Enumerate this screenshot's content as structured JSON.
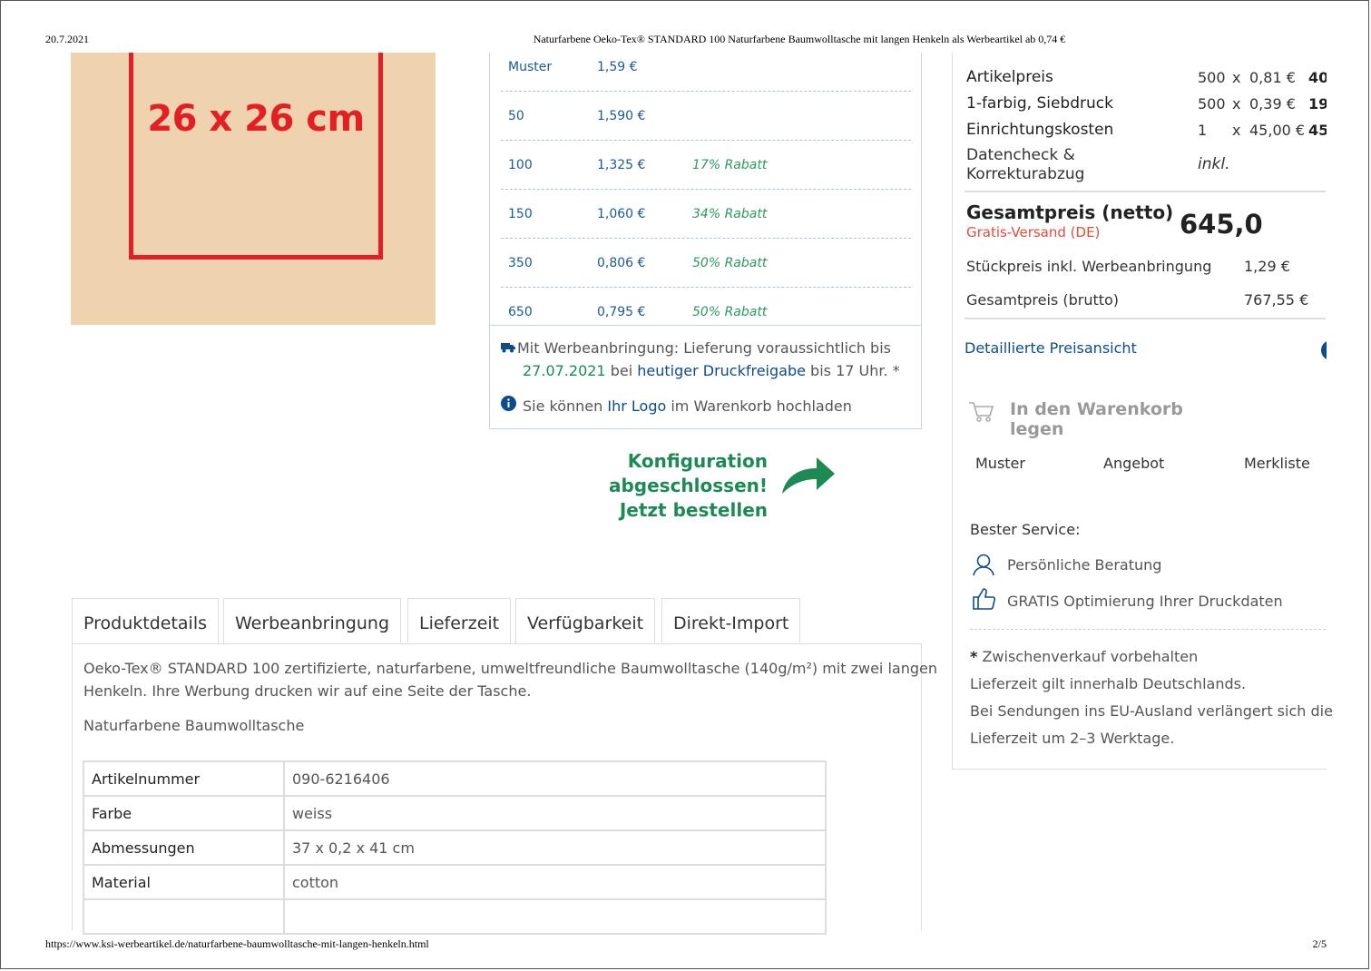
{
  "print_header": {
    "date": "20.7.2021",
    "title": "Naturfarbene Oeko-Tex® STANDARD 100 Naturfarbene Baumwolltasche mit langen Henkeln als Werbeartikel ab 0,74 €"
  },
  "print_footer": {
    "url": "https://www.ksi-werbeartikel.de/naturfarbene-baumwolltasche-mit-langen-henkeln.html",
    "page": "2/5"
  },
  "product_image": {
    "dimension_label": "26 x 26 cm"
  },
  "price_tiers": [
    {
      "qty": "Muster",
      "price": "1,59 €",
      "rabatt": ""
    },
    {
      "qty": "50",
      "price": "1,590 €",
      "rabatt": ""
    },
    {
      "qty": "100",
      "price": "1,325 €",
      "rabatt": "17% Rabatt"
    },
    {
      "qty": "150",
      "price": "1,060 €",
      "rabatt": "34% Rabatt"
    },
    {
      "qty": "350",
      "price": "0,806 €",
      "rabatt": "50% Rabatt"
    },
    {
      "qty": "650",
      "price": "0,795 €",
      "rabatt": "50% Rabatt"
    }
  ],
  "delivery": {
    "line1": "Mit Werbeanbringung: Lieferung voraussichtlich bis",
    "date": "27.07.2021",
    "bei": " bei ",
    "link": "heutiger Druckfreigabe",
    "suffix": " bis 17 Uhr. *"
  },
  "logo_info": {
    "prefix": "Sie können ",
    "link": "Ihr Logo",
    "suffix": " im Warenkorb hochladen"
  },
  "konfig": {
    "line1": "Konfiguration abgeschlossen!",
    "line2": "Jetzt bestellen"
  },
  "tabs": [
    "Produktdetails",
    "Werbeanbringung",
    "Lieferzeit",
    "Verfügbarkeit",
    "Direkt-Import"
  ],
  "description": {
    "para1_line1": "Oeko-Tex® STANDARD 100 zertifizierte, naturfarbene, umweltfreundliche Baumwolltasche (140g/m²) mit zwei langen",
    "para1_line2": "Henkeln. Ihre Werbung drucken wir auf eine Seite der Tasche.",
    "para2": "Naturfarbene Baumwolltasche"
  },
  "specs": [
    {
      "key": "Artikelnummer",
      "value": "090-6216406"
    },
    {
      "key": "Farbe",
      "value": "weiss"
    },
    {
      "key": "Abmessungen",
      "value": "37 x 0,2 x 41 cm"
    },
    {
      "key": "Material",
      "value": "cotton"
    },
    {
      "key": "",
      "value": ""
    }
  ],
  "summary": {
    "rows": [
      {
        "label": "Artikelpreis",
        "qty": "500",
        "x": "x",
        "unit": "0,81 €",
        "total": "40"
      },
      {
        "label": "1-farbig, Siebdruck",
        "qty": "500",
        "x": "x",
        "unit": "0,39 €",
        "total": "19"
      },
      {
        "label": "Einrichtungskosten",
        "qty": "1",
        "x": "x",
        "unit": "45,00 €",
        "total": "45"
      }
    ],
    "datencheck_line1": "Datencheck &",
    "datencheck_line2": "Korrekturabzug",
    "datencheck_value": "inkl.",
    "gesamt_label": "Gesamtpreis (netto)",
    "gesamt_value": "645,0",
    "versand": "Gratis-Versand (DE)",
    "stueck_label": "Stückpreis inkl. Werbeanbringung",
    "stueck_value": "1,29 €",
    "brutto_label": "Gesamtpreis (brutto)",
    "brutto_value": "767,55 €",
    "detail_link": "Detaillierte Preisansicht"
  },
  "cart_button": "In den Warenkorb legen",
  "actions": [
    "Muster",
    "Angebot",
    "Merkliste"
  ],
  "service": {
    "title": "Bester Service:",
    "items": [
      "Persönliche Beratung",
      "GRATIS Optimierung Ihrer Druckdaten"
    ]
  },
  "notes": {
    "star": "*",
    "line1": " Zwischenverkauf vorbehalten",
    "line2": "Lieferzeit gilt innerhalb Deutschlands.",
    "line3": "Bei Sendungen ins EU-Ausland verlängert sich die",
    "line4": "Lieferzeit um 2–3 Werktage."
  },
  "colors": {
    "accent_red": "#e31e24",
    "link_blue": "#0d4c8c",
    "green": "#1d8a56",
    "bag": "#efd3ae"
  }
}
